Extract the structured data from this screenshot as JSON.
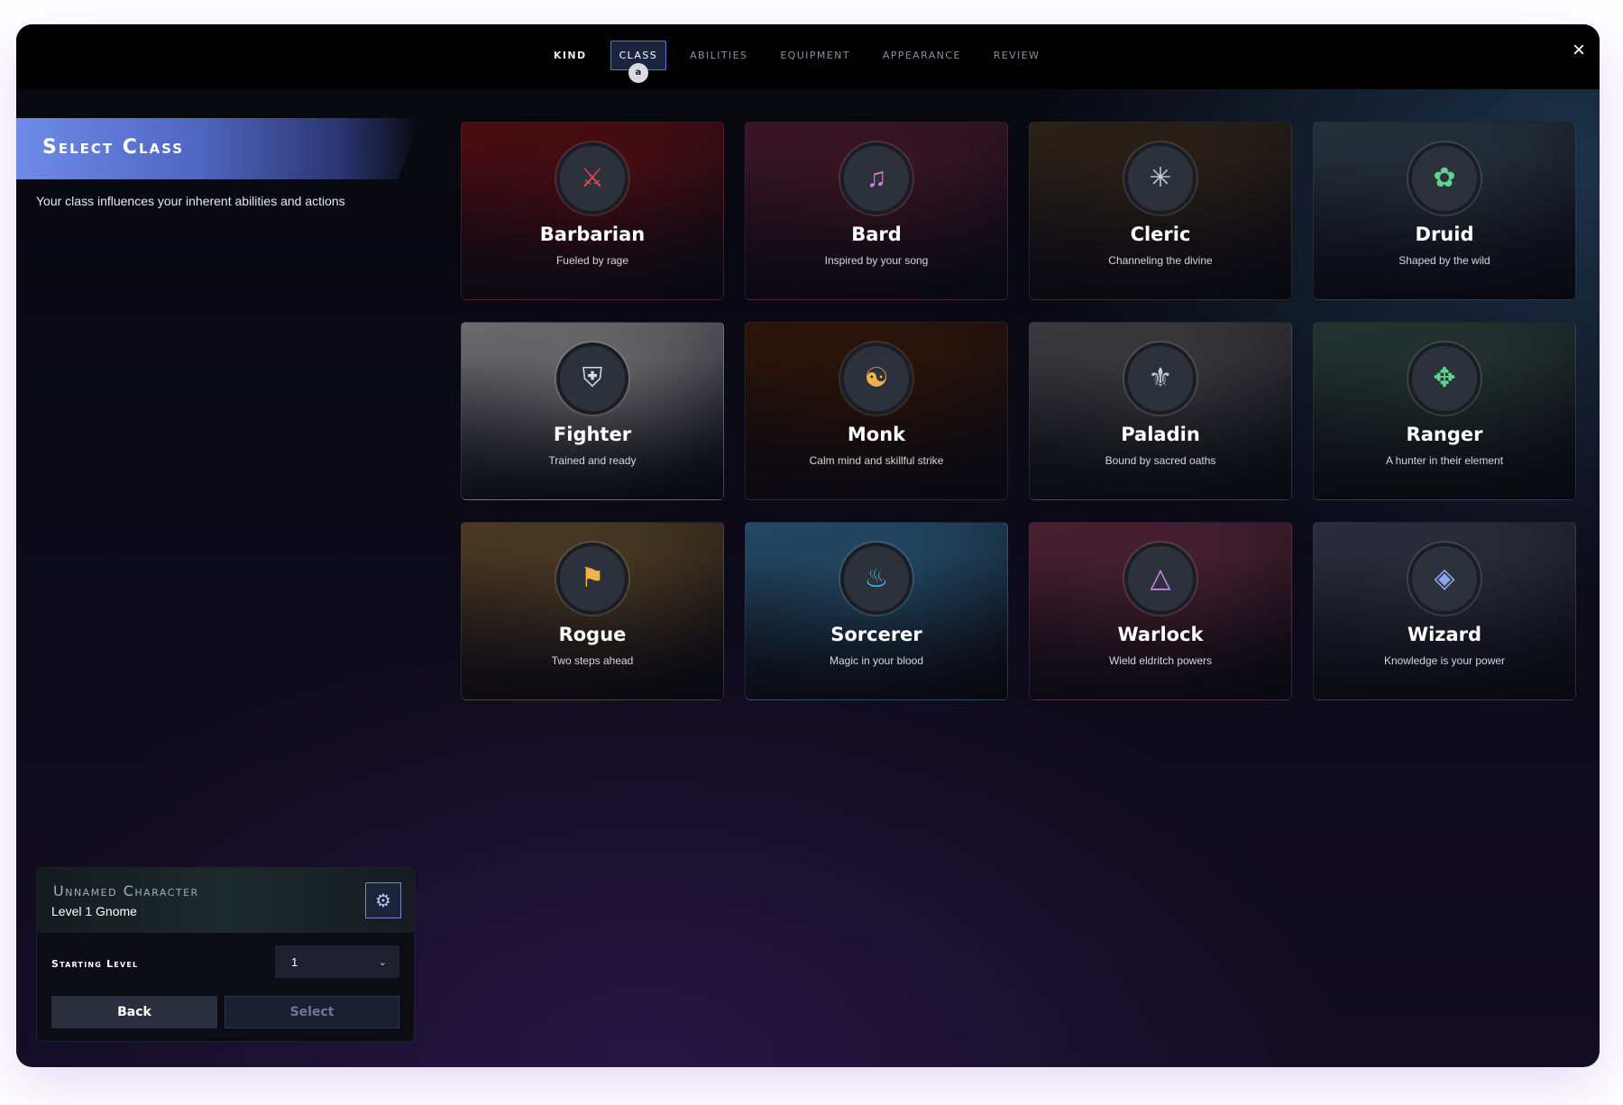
{
  "tabs": [
    {
      "label": "KIND",
      "state": "done"
    },
    {
      "label": "CLASS",
      "state": "active",
      "hint": "a"
    },
    {
      "label": "ABILITIES",
      "state": "inactive"
    },
    {
      "label": "EQUIPMENT",
      "state": "inactive"
    },
    {
      "label": "APPEARANCE",
      "state": "inactive"
    },
    {
      "label": "REVIEW",
      "state": "inactive"
    }
  ],
  "close_icon": "×",
  "left": {
    "title": "Select Class",
    "description": "Your class influences your inherent abilities and actions"
  },
  "classes": [
    {
      "name": "Barbarian",
      "subtitle": "Fueled by rage",
      "icon": "axes-icon",
      "glyph": "⚔",
      "color": "#e8484c",
      "bg": "#4a0c12"
    },
    {
      "name": "Bard",
      "subtitle": "Inspired by your song",
      "icon": "lute-icon",
      "glyph": "♫",
      "color": "#e07ad8",
      "bg": "#3b1524"
    },
    {
      "name": "Cleric",
      "subtitle": "Channeling the divine",
      "icon": "radiance-icon",
      "glyph": "✳",
      "color": "#c8ccd6",
      "bg": "#2a2117"
    },
    {
      "name": "Druid",
      "subtitle": "Shaped by the wild",
      "icon": "paw-icon",
      "glyph": "✿",
      "color": "#5fd68e",
      "bg": "#25303a"
    },
    {
      "name": "Fighter",
      "subtitle": "Trained and ready",
      "icon": "helm-icon",
      "glyph": "⛨",
      "color": "#d8dbe3",
      "bg": "#6d6c70"
    },
    {
      "name": "Monk",
      "subtitle": "Calm mind and skillful strike",
      "icon": "meditation-icon",
      "glyph": "☯",
      "color": "#f0b24a",
      "bg": "#2c1408"
    },
    {
      "name": "Paladin",
      "subtitle": "Bound by sacred oaths",
      "icon": "winged-sword-icon",
      "glyph": "⚜",
      "color": "#c8ccd6",
      "bg": "#3a3a3e"
    },
    {
      "name": "Ranger",
      "subtitle": "A hunter in their element",
      "icon": "paw-arrows-icon",
      "glyph": "✥",
      "color": "#58d68a",
      "bg": "#243430"
    },
    {
      "name": "Rogue",
      "subtitle": "Two steps ahead",
      "icon": "dagger-icon",
      "glyph": "⚑",
      "color": "#f0b24a",
      "bg": "#4a3a22"
    },
    {
      "name": "Sorcerer",
      "subtitle": "Magic in your blood",
      "icon": "flame-icon",
      "glyph": "♨",
      "color": "#4ab8e8",
      "bg": "#234a66"
    },
    {
      "name": "Warlock",
      "subtitle": "Wield eldritch powers",
      "icon": "triangle-sigil-icon",
      "glyph": "△",
      "color": "#c28ae0",
      "bg": "#4a2030"
    },
    {
      "name": "Wizard",
      "subtitle": "Knowledge is your power",
      "icon": "rune-icon",
      "glyph": "◈",
      "color": "#8aa6ee",
      "bg": "#2a2e3a"
    }
  ],
  "character": {
    "name": "Unnamed Character",
    "level_line": "Level 1 Gnome",
    "avatar_icon": "gnome-emblem-icon",
    "starting_level_label": "Starting Level",
    "starting_level_value": "1"
  },
  "buttons": {
    "back": "Back",
    "select": "Select"
  }
}
